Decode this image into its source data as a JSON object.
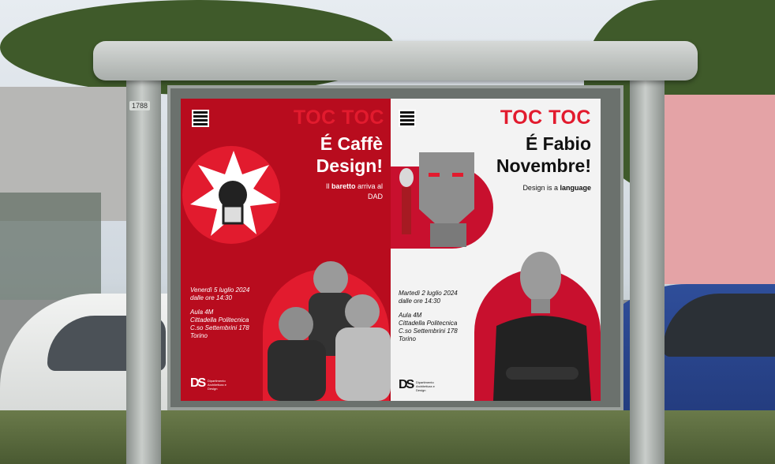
{
  "billboard": {
    "post_number": "1788",
    "left_poster": {
      "title_line1": "TOC TOC",
      "title_line2": "É Caffè",
      "title_line3": "Design!",
      "subtitle_prefix": "Il",
      "subtitle_bold": "baretto",
      "subtitle_rest": "arriva al",
      "subtitle_line2": "DAD",
      "date": "Venerdì 5 luglio 2024",
      "time": "dalle ore 14:30",
      "room": "Aula 4M",
      "place": "Cittadella Politecnica",
      "address": "C.so Settembrini 178",
      "city": "Torino",
      "logo": "DS",
      "logo_caption": "Dipartimento Architettura e Design"
    },
    "right_poster": {
      "title_line1": "TOC TOC",
      "title_line2": "É Fabio",
      "title_line3": "Novembre!",
      "subtitle_prefix": "Design is a",
      "subtitle_bold": "language",
      "date": "Martedì 2 luglio 2024",
      "time": "dalle ore 14:30",
      "room": "Aula 4M",
      "place": "Cittadella Politecnica",
      "address": "C.so Settembrini 178",
      "city": "Torino",
      "logo": "DS",
      "logo_caption": "Dipartimento Architettura e Design"
    }
  },
  "colors": {
    "poster_red": "#b80c1e",
    "accent_red": "#e21b2e",
    "poster_white": "#f3f3f3"
  }
}
